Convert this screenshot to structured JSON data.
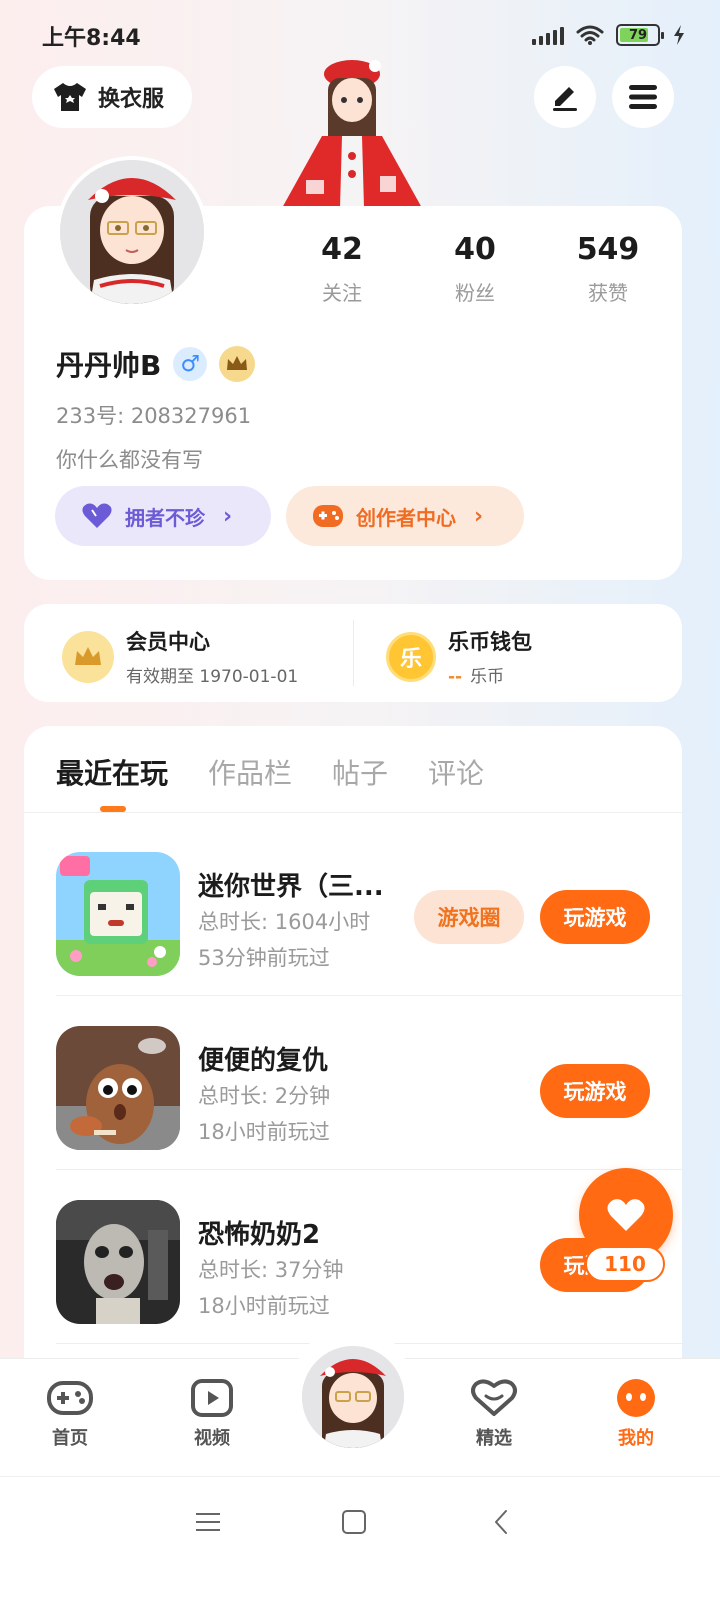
{
  "status_bar": {
    "time": "上午8:44",
    "battery": "79"
  },
  "header": {
    "outfit_label": "换衣服"
  },
  "profile": {
    "stats": [
      {
        "value": "42",
        "label": "关注"
      },
      {
        "value": "40",
        "label": "粉丝"
      },
      {
        "value": "549",
        "label": "获赞"
      }
    ],
    "username": "丹丹帅B",
    "gender_symbol": "♂",
    "uid": "233号: 208327961",
    "bio": "你什么都没有写",
    "pills": [
      {
        "label": "拥者不珍",
        "icon": "heart-icon"
      },
      {
        "label": "创作者中心",
        "icon": "gamepad-icon"
      }
    ]
  },
  "membership": {
    "vip_title": "会员中心",
    "vip_sub": "有效期至 1970-01-01",
    "wallet_title": "乐币钱包",
    "wallet_icon_text": "乐",
    "wallet_dash": "--",
    "wallet_unit": "乐币"
  },
  "tabs": [
    "最近在玩",
    "作品栏",
    "帖子",
    "评论"
  ],
  "active_tab": 0,
  "games": [
    {
      "title": "迷你世界（三...",
      "duration": "总时长: 1604小时",
      "last_played": "53分钟前玩过",
      "circle_label": "游戏圈",
      "play_label": "玩游戏"
    },
    {
      "title": "便便的复仇",
      "duration": "总时长: 2分钟",
      "last_played": "18小时前玩过",
      "play_label": "玩游戏"
    },
    {
      "title": "恐怖奶奶2",
      "duration": "总时长: 37分钟",
      "last_played": "18小时前玩过",
      "play_label": "玩游戏"
    }
  ],
  "fab": {
    "count": "110"
  },
  "bottom_nav": [
    {
      "label": "首页",
      "icon": "gamepad-icon"
    },
    {
      "label": "视频",
      "icon": "video-icon"
    },
    {
      "label": "精选",
      "icon": "heart-badge-icon"
    },
    {
      "label": "我的",
      "icon": "face-icon",
      "active": true
    }
  ],
  "colors": {
    "accent": "#ff6a12",
    "purple": "#6b5bd6"
  }
}
